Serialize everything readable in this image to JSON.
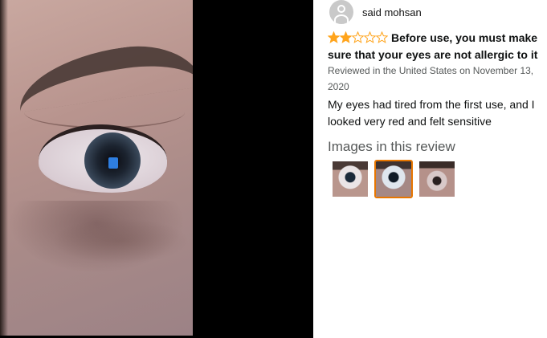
{
  "reviewer": {
    "name": "said mohsan",
    "avatar_icon": "user-silhouette-icon"
  },
  "review": {
    "rating": 2,
    "rating_max": 5,
    "star_color": "#FFA41C",
    "title": "Before use, you must make sure that your eyes are not allergic to it",
    "meta": "Reviewed in the United States on November 13, 2020",
    "body": "My eyes had tired from the first use, and I looked very red and felt sensitive"
  },
  "images": {
    "heading": "Images in this review",
    "selected_index": 1,
    "selected_border_color": "#E77600",
    "count": 3
  }
}
